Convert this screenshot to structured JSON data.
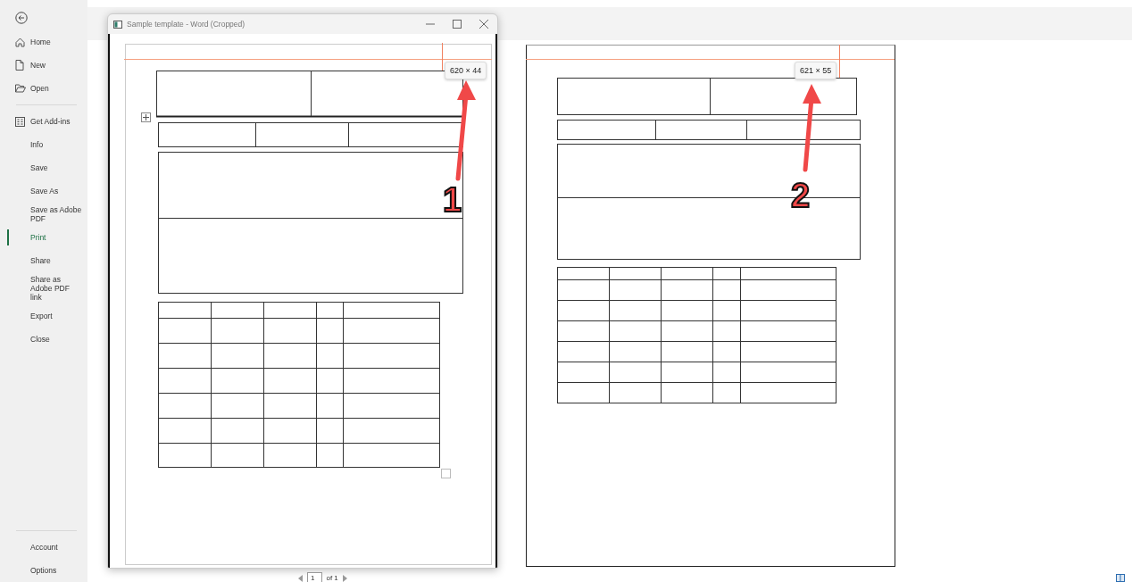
{
  "sidebar": {
    "groups": [
      {
        "items": [
          {
            "label": "Home",
            "selected": false
          },
          {
            "label": "New",
            "selected": false
          },
          {
            "label": "Open",
            "selected": false
          }
        ]
      },
      {
        "items": [
          {
            "label": "Get Add-ins",
            "selected": false
          },
          {
            "label": "Info",
            "selected": false
          },
          {
            "label": "Save",
            "selected": false
          },
          {
            "label": "Save As",
            "selected": false
          },
          {
            "label": "Save as Adobe PDF",
            "selected": false
          },
          {
            "label": "Print",
            "selected": true
          },
          {
            "label": "Share",
            "selected": false
          },
          {
            "label": "Share as Adobe PDF link",
            "selected": false
          },
          {
            "label": "Export",
            "selected": false
          },
          {
            "label": "Close",
            "selected": false
          }
        ]
      },
      {
        "items": [
          {
            "label": "Account",
            "selected": false
          },
          {
            "label": "Options",
            "selected": false
          }
        ]
      }
    ]
  },
  "preview_window": {
    "title": "Sample template - Word (Cropped)",
    "size_tooltip": "620 × 44"
  },
  "print_preview": {
    "size_tooltip": "621 × 55",
    "page_number": "1",
    "page_count": "of 1"
  },
  "annotations": [
    {
      "label": "1"
    },
    {
      "label": "2"
    }
  ]
}
